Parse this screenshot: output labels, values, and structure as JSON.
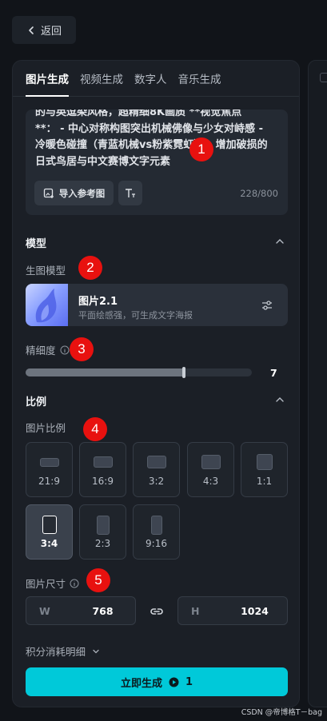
{
  "back": {
    "label": "返回"
  },
  "tabs": [
    {
      "label": "图片生成",
      "active": true
    },
    {
      "label": "视频生成",
      "active": false
    },
    {
      "label": "数字人",
      "active": false
    },
    {
      "label": "音乐生成",
      "active": false
    }
  ],
  "prompt": {
    "lines": [
      "的与英逗染风格，超精细8K画质 **视觉焦点",
      "**：  - 中心对称构图突出机械佛像与少女对峙感  -",
      "冷暖色碰撞（青蓝机械vs粉紫霓虹）  - 增加破损的",
      "日式鸟居与中文赛博文字元素"
    ],
    "import_label": "导入参考图",
    "counter": "228/800"
  },
  "model_section": {
    "title": "模型",
    "sub_label": "生图模型",
    "model_name": "图片2.1",
    "model_desc": "平面绘感强，可生成文字海报"
  },
  "precision": {
    "label": "精细度",
    "value": "7",
    "fill_fraction": 0.7
  },
  "ratio_section": {
    "title": "比例",
    "sub_label": "图片比例",
    "options": [
      {
        "label": "21:9",
        "active": false
      },
      {
        "label": "16:9",
        "active": false
      },
      {
        "label": "3:2",
        "active": false
      },
      {
        "label": "4:3",
        "active": false
      },
      {
        "label": "1:1",
        "active": false
      },
      {
        "label": "3:4",
        "active": true
      },
      {
        "label": "2:3",
        "active": false
      },
      {
        "label": "9:16",
        "active": false
      }
    ]
  },
  "size": {
    "label": "图片尺寸",
    "w_prefix": "W",
    "w_value": "768",
    "h_prefix": "H",
    "h_value": "1024"
  },
  "credits": {
    "label": "积分消耗明细"
  },
  "generate": {
    "label": "立即生成",
    "cost": "1"
  },
  "badges": [
    "1",
    "2",
    "3",
    "4",
    "5"
  ],
  "watermark": "CSDN @帝博格T－bag",
  "colors": {
    "accent": "#00c9d9",
    "badge": "#e8110f"
  }
}
